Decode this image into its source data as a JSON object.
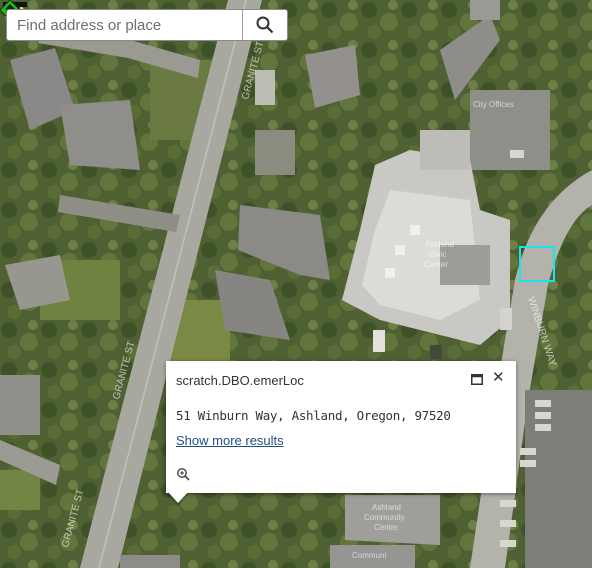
{
  "search": {
    "placeholder": "Find address or place"
  },
  "popup": {
    "title": "scratch.DBO.emerLoc",
    "address": "51 Winburn Way, Ashland, Oregon, 97520",
    "show_more": "Show more results"
  },
  "map_labels": {
    "granite_st_upper": "GRANITE ST",
    "granite_st_lower": "GRANITE ST",
    "winburn_way": "WINBURN WAY",
    "city_offices": "City Offices",
    "civic_center_1": "Ashland",
    "civic_center_2": "Civic",
    "civic_center_3": "Center",
    "community_center_1": "Ashland",
    "community_center_2": "Community",
    "community_center_3": "Center",
    "community_lower": "Communi"
  },
  "colors": {
    "highlight": "#17e4ee",
    "marker_yellow": "#f2e600",
    "marker_green": "#1cc21c"
  },
  "icons": [
    "search-icon",
    "maximize-icon",
    "close-icon",
    "zoom-to-icon",
    "location-marker-icon",
    "emergency-location-icon"
  ]
}
